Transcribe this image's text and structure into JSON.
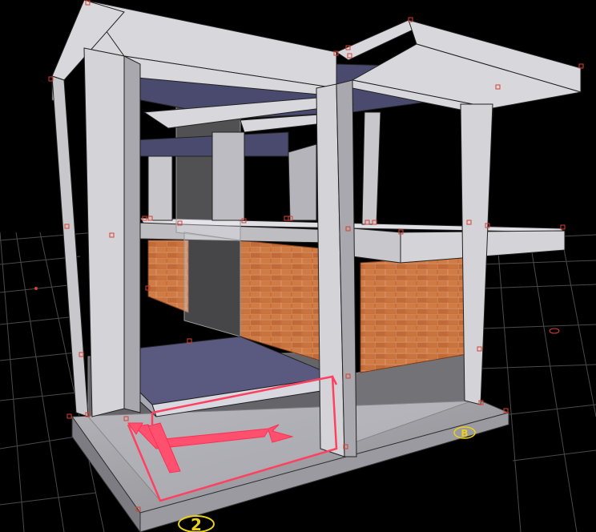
{
  "viewport": {
    "background": "#000000",
    "grid_color": "#4a4a4a",
    "concrete_color": "#c8c8cc",
    "brick_color": "#c8703c",
    "slab_underside_color": "#4a4a6e",
    "selection_color": "#ff4060",
    "vertex_marker_color": "#d84030",
    "axis_marker_color": "#e8d020"
  },
  "axis_markers": {
    "front": "2",
    "right": "B"
  }
}
